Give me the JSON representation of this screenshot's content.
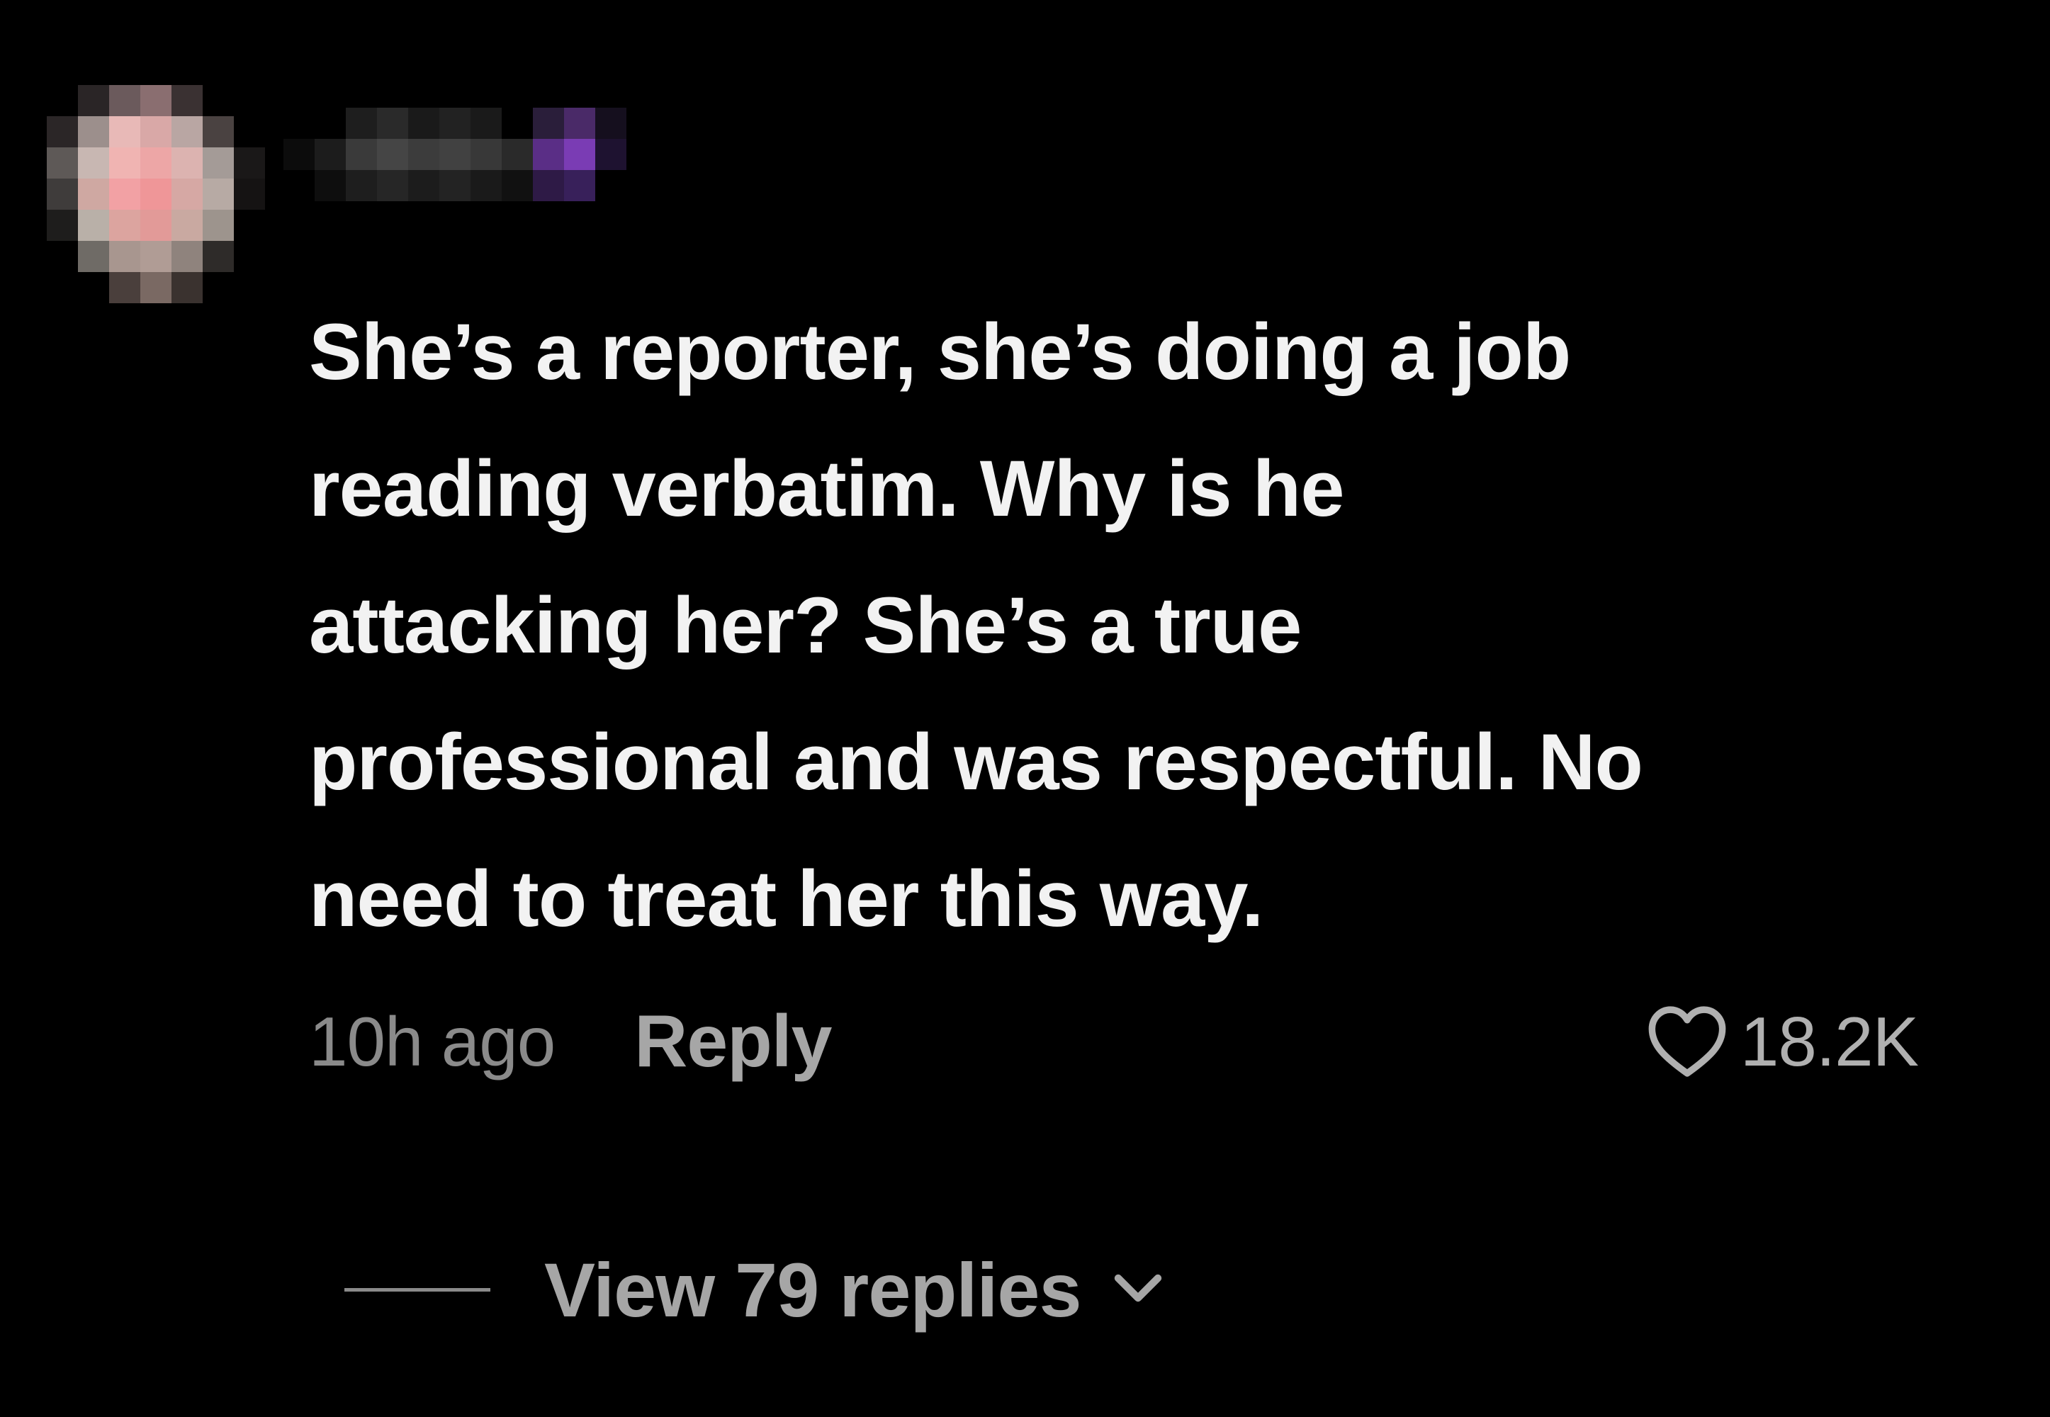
{
  "comment": {
    "text_lines": [
      "She’s a reporter, she’s doing a job",
      "reading verbatim. Why is he",
      "attacking her? She’s a true",
      "professional and was respectful. No",
      "need to treat her this way."
    ],
    "timestamp": "10h ago",
    "reply_label": "Reply",
    "like_count": "18.2K",
    "like_icon": "heart-outline-icon",
    "view_replies_label": "View 79 replies",
    "view_replies_icon": "chevron-down-icon"
  },
  "colors": {
    "background": "#000000",
    "text_primary": "#f2f2f2",
    "text_secondary": "#8a8a8a",
    "reply": "#a6a6a6"
  }
}
